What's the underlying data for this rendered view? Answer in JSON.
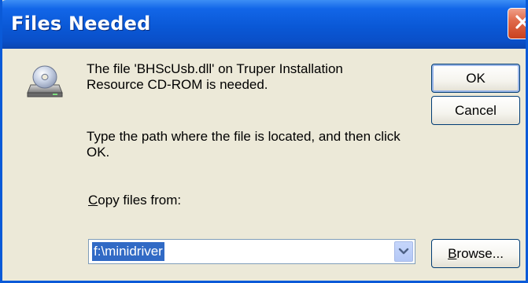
{
  "window": {
    "title": "Files Needed"
  },
  "message": {
    "line1": "The file 'BHScUsb.dll' on Truper Installation Resource CD-ROM is needed.",
    "line2": "Type the path where the file is located, and then click OK."
  },
  "copy_from": {
    "label_mnemonic": "C",
    "label_rest": "opy files from:",
    "value": "f:\\minidriver"
  },
  "buttons": {
    "ok": "OK",
    "cancel": "Cancel",
    "browse_mnemonic": "B",
    "browse_rest": "rowse..."
  },
  "icons": {
    "cd": "cd-drive-icon",
    "close": "close-icon",
    "dropdown": "chevron-down-icon"
  },
  "colors": {
    "titlebar": "#0a58d6",
    "close_button": "#e06a4a",
    "selection": "#316ac5",
    "dialog_bg": "#ece9d8"
  }
}
